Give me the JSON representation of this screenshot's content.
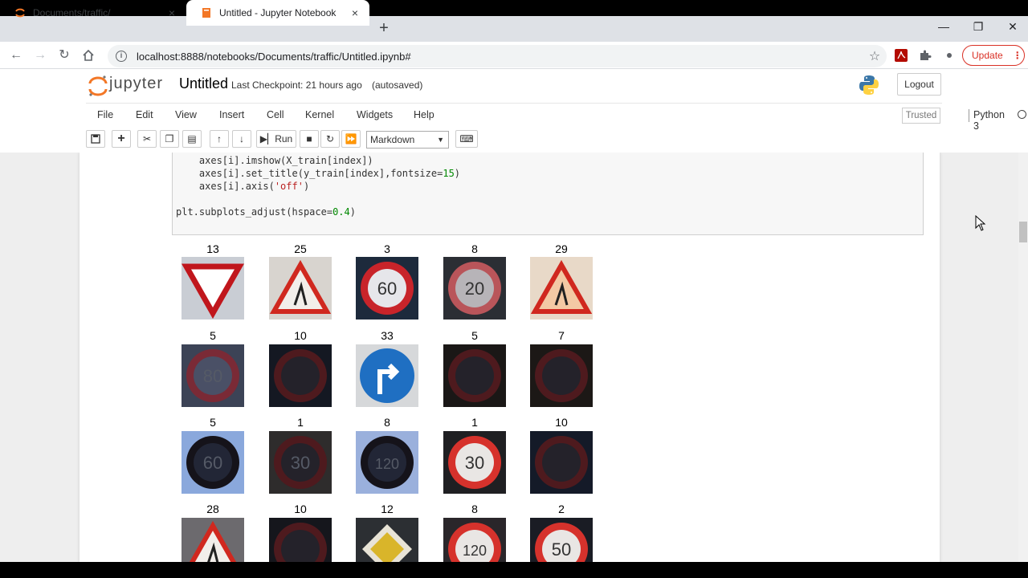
{
  "browser": {
    "tabs": [
      {
        "title": "Documents/traffic/",
        "active": false
      },
      {
        "title": "Untitled - Jupyter Notebook",
        "active": true
      }
    ],
    "tab_close": "×",
    "new_tab": "+",
    "url": "localhost:8888/notebooks/Documents/traffic/Untitled.ipynb#",
    "update_label": "Update",
    "update_dots": "⋮"
  },
  "jupyter": {
    "logo_text": "jupyter",
    "notebook_name": "Untitled",
    "checkpoint": "Last Checkpoint: 21 hours ago",
    "autosaved": "(autosaved)",
    "logout_label": "Logout",
    "menu": [
      "File",
      "Edit",
      "View",
      "Insert",
      "Cell",
      "Kernel",
      "Widgets",
      "Help"
    ],
    "trusted": "Trusted",
    "kernel": "Python 3",
    "run_label": "Run",
    "cell_type": "Markdown"
  },
  "code": {
    "lines": [
      {
        "pre": "    axes[i].imshow(X_train[index])",
        "num": "",
        "post": "",
        "str": ""
      },
      {
        "pre": "    axes[i].set_title(y_train[index],fontsize=",
        "num": "15",
        "post": ")",
        "str": ""
      },
      {
        "pre": "    axes[i].axis(",
        "num": "",
        "post": ")",
        "str": "'off'"
      },
      {
        "pre": "plt.subplots_adjust(hspace=",
        "num": "0.4",
        "post": ")",
        "str": ""
      }
    ]
  },
  "figure": {
    "rows": [
      [
        "13",
        "25",
        "3",
        "8",
        "29"
      ],
      [
        "5",
        "10",
        "33",
        "5",
        "7"
      ],
      [
        "5",
        "1",
        "8",
        "1",
        "10"
      ],
      [
        "28",
        "10",
        "12",
        "8",
        "2"
      ]
    ],
    "sign_text": [
      [
        "",
        "",
        "60",
        "20",
        "",
        ""
      ],
      [
        "80",
        "",
        "",
        "",
        ""
      ],
      [
        "60",
        "30",
        "120",
        "30",
        ""
      ],
      [
        "",
        "",
        "",
        "120",
        "50"
      ]
    ]
  },
  "colors": {
    "jupyter_orange": "#f37726",
    "update_red": "#d93025",
    "code_number": "#008800",
    "code_string": "#ba2121"
  }
}
